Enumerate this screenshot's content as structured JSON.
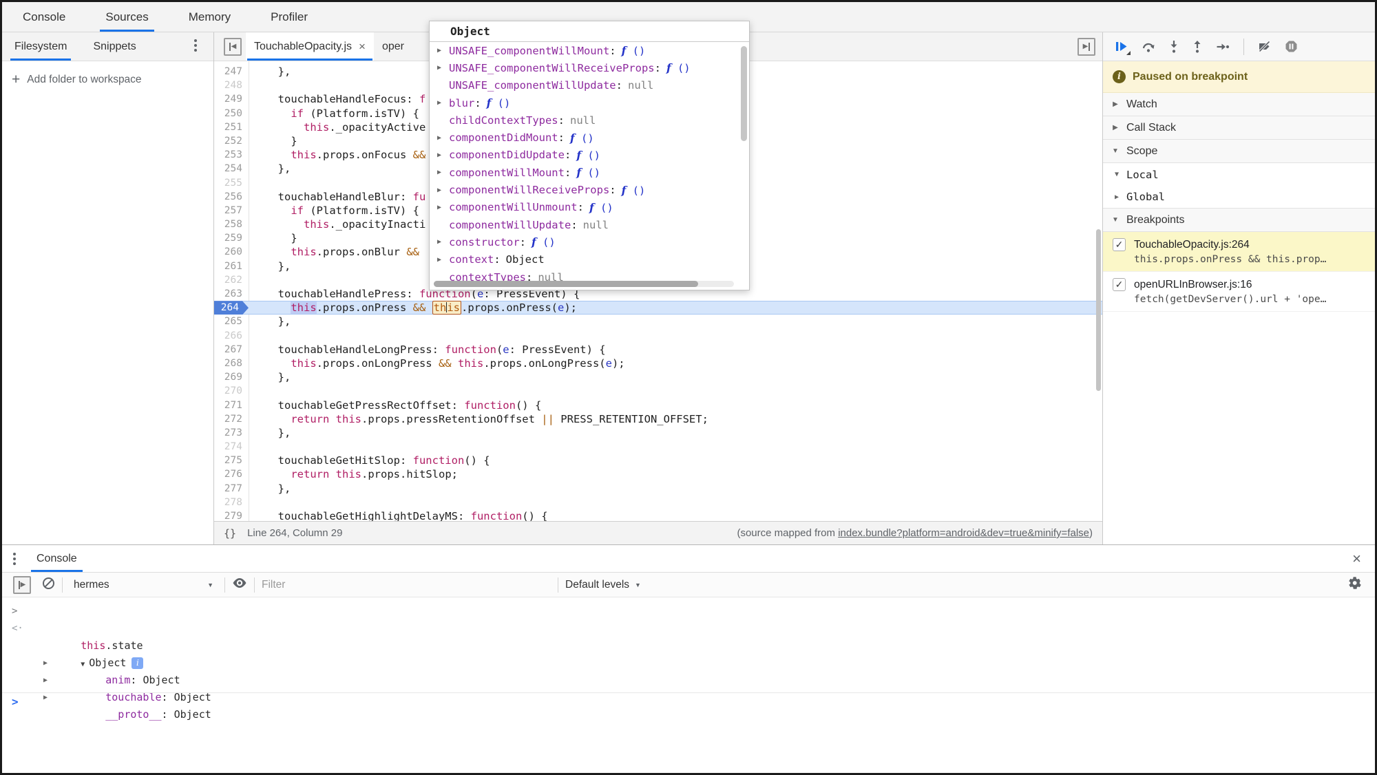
{
  "main_tabs": {
    "items": [
      {
        "label": "Console",
        "active": false
      },
      {
        "label": "Sources",
        "active": true
      },
      {
        "label": "Memory",
        "active": false
      },
      {
        "label": "Profiler",
        "active": false
      }
    ]
  },
  "sidebar": {
    "tabs": [
      {
        "label": "Filesystem",
        "active": true
      },
      {
        "label": "Snippets",
        "active": false
      }
    ],
    "add_folder_label": "Add folder to workspace"
  },
  "editor": {
    "nav_tabs": [
      {
        "label": "TouchableOpacity.js",
        "active": true
      },
      {
        "label": "oper",
        "active": false
      }
    ],
    "current_line": 264,
    "status_left": "Line 264, Column 29",
    "status_right_prefix": "(source mapped from ",
    "status_right_link": "index.bundle?platform=android&dev=true&minify=false",
    "status_right_suffix": ")",
    "lines": [
      {
        "n": 247,
        "t": [
          [
            "p",
            "  },"
          ]
        ]
      },
      {
        "n": 248,
        "t": []
      },
      {
        "n": 249,
        "t": [
          [
            "p",
            "  touchableHandleFocus: "
          ],
          [
            "k",
            "f"
          ]
        ]
      },
      {
        "n": 250,
        "t": [
          [
            "p",
            "    "
          ],
          [
            "k",
            "if"
          ],
          [
            "p",
            " (Platform.isTV) {"
          ]
        ]
      },
      {
        "n": 251,
        "t": [
          [
            "p",
            "      "
          ],
          [
            "k",
            "this"
          ],
          [
            "p",
            "._opacityActive"
          ]
        ]
      },
      {
        "n": 252,
        "t": [
          [
            "p",
            "    }"
          ]
        ]
      },
      {
        "n": 253,
        "t": [
          [
            "p",
            "    "
          ],
          [
            "k",
            "this"
          ],
          [
            "p",
            ".props.onFocus "
          ],
          [
            "o",
            "&&"
          ]
        ]
      },
      {
        "n": 254,
        "t": [
          [
            "p",
            "  },"
          ]
        ]
      },
      {
        "n": 255,
        "t": []
      },
      {
        "n": 256,
        "t": [
          [
            "p",
            "  touchableHandleBlur: "
          ],
          [
            "k",
            "fu"
          ]
        ]
      },
      {
        "n": 257,
        "t": [
          [
            "p",
            "    "
          ],
          [
            "k",
            "if"
          ],
          [
            "p",
            " (Platform.isTV) {"
          ]
        ]
      },
      {
        "n": 258,
        "t": [
          [
            "p",
            "      "
          ],
          [
            "k",
            "this"
          ],
          [
            "p",
            "._opacityInacti"
          ]
        ]
      },
      {
        "n": 259,
        "t": [
          [
            "p",
            "    }"
          ]
        ]
      },
      {
        "n": 260,
        "t": [
          [
            "p",
            "    "
          ],
          [
            "k",
            "this"
          ],
          [
            "p",
            ".props.onBlur "
          ],
          [
            "o",
            "&&"
          ]
        ]
      },
      {
        "n": 261,
        "t": [
          [
            "p",
            "  },"
          ]
        ]
      },
      {
        "n": 262,
        "t": []
      },
      {
        "n": 263,
        "t": [
          [
            "p",
            "  touchableHandlePress: "
          ],
          [
            "k",
            "function"
          ],
          [
            "p",
            "("
          ],
          [
            "b",
            "e"
          ],
          [
            "p",
            ": PressEvent) {"
          ]
        ]
      },
      {
        "n": 264,
        "t": [
          [
            "p",
            "    "
          ],
          [
            "sel",
            "this"
          ],
          [
            "p",
            ".props.onPress "
          ],
          [
            "o",
            "&&"
          ],
          [
            "p",
            " "
          ],
          [
            "box",
            "this"
          ],
          [
            "p",
            ".props.onPress("
          ],
          [
            "b",
            "e"
          ],
          [
            "p",
            ");"
          ]
        ]
      },
      {
        "n": 265,
        "t": [
          [
            "p",
            "  },"
          ]
        ]
      },
      {
        "n": 266,
        "t": []
      },
      {
        "n": 267,
        "t": [
          [
            "p",
            "  touchableHandleLongPress: "
          ],
          [
            "k",
            "function"
          ],
          [
            "p",
            "("
          ],
          [
            "b",
            "e"
          ],
          [
            "p",
            ": PressEvent) {"
          ]
        ]
      },
      {
        "n": 268,
        "t": [
          [
            "p",
            "    "
          ],
          [
            "k",
            "this"
          ],
          [
            "p",
            ".props.onLongPress "
          ],
          [
            "o",
            "&&"
          ],
          [
            "p",
            " "
          ],
          [
            "k",
            "this"
          ],
          [
            "p",
            ".props.onLongPress("
          ],
          [
            "b",
            "e"
          ],
          [
            "p",
            ");"
          ]
        ]
      },
      {
        "n": 269,
        "t": [
          [
            "p",
            "  },"
          ]
        ]
      },
      {
        "n": 270,
        "t": []
      },
      {
        "n": 271,
        "t": [
          [
            "p",
            "  touchableGetPressRectOffset: "
          ],
          [
            "k",
            "function"
          ],
          [
            "p",
            "() {"
          ]
        ]
      },
      {
        "n": 272,
        "t": [
          [
            "p",
            "    "
          ],
          [
            "k",
            "return"
          ],
          [
            "p",
            " "
          ],
          [
            "k",
            "this"
          ],
          [
            "p",
            ".props.pressRetentionOffset "
          ],
          [
            "o",
            "||"
          ],
          [
            "p",
            " PRESS_RETENTION_OFFSET;"
          ]
        ]
      },
      {
        "n": 273,
        "t": [
          [
            "p",
            "  },"
          ]
        ]
      },
      {
        "n": 274,
        "t": []
      },
      {
        "n": 275,
        "t": [
          [
            "p",
            "  touchableGetHitSlop: "
          ],
          [
            "k",
            "function"
          ],
          [
            "p",
            "() {"
          ]
        ]
      },
      {
        "n": 276,
        "t": [
          [
            "p",
            "    "
          ],
          [
            "k",
            "return"
          ],
          [
            "p",
            " "
          ],
          [
            "k",
            "this"
          ],
          [
            "p",
            ".props.hitSlop;"
          ]
        ]
      },
      {
        "n": 277,
        "t": [
          [
            "p",
            "  },"
          ]
        ]
      },
      {
        "n": 278,
        "t": []
      },
      {
        "n": 279,
        "t": [
          [
            "p",
            "  touchableGetHighlightDelayMS: "
          ],
          [
            "k",
            "function"
          ],
          [
            "p",
            "() {"
          ]
        ]
      }
    ]
  },
  "popup": {
    "title": "Object",
    "props": [
      {
        "a": true,
        "name": "UNSAFE_componentWillMount",
        "v": "f ()",
        "vt": "fn"
      },
      {
        "a": true,
        "name": "UNSAFE_componentWillReceiveProps",
        "v": "f ()",
        "vt": "fn"
      },
      {
        "a": false,
        "name": "UNSAFE_componentWillUpdate",
        "v": "null",
        "vt": "null"
      },
      {
        "a": true,
        "name": "blur",
        "v": "f ()",
        "vt": "fn"
      },
      {
        "a": false,
        "name": "childContextTypes",
        "v": "null",
        "vt": "null"
      },
      {
        "a": true,
        "name": "componentDidMount",
        "v": "f ()",
        "vt": "fn"
      },
      {
        "a": true,
        "name": "componentDidUpdate",
        "v": "f ()",
        "vt": "fn"
      },
      {
        "a": true,
        "name": "componentWillMount",
        "v": "f ()",
        "vt": "fn"
      },
      {
        "a": true,
        "name": "componentWillReceiveProps",
        "v": "f ()",
        "vt": "fn"
      },
      {
        "a": true,
        "name": "componentWillUnmount",
        "v": "f ()",
        "vt": "fn"
      },
      {
        "a": false,
        "name": "componentWillUpdate",
        "v": "null",
        "vt": "null"
      },
      {
        "a": true,
        "name": "constructor",
        "v": "f ()",
        "vt": "fn"
      },
      {
        "a": true,
        "name": "context",
        "v": "Object",
        "vt": "obj"
      },
      {
        "a": false,
        "name": "contextTypes",
        "v": "null",
        "vt": "null"
      }
    ]
  },
  "debug_panel": {
    "paused_label": "Paused on breakpoint",
    "sections": [
      {
        "label": "Watch",
        "expanded": false
      },
      {
        "label": "Call Stack",
        "expanded": false
      },
      {
        "label": "Scope",
        "expanded": true
      }
    ],
    "scope_items": [
      {
        "label": "Local",
        "expanded": true
      },
      {
        "label": "Global",
        "expanded": false
      }
    ],
    "breakpoints_label": "Breakpoints",
    "breakpoints": [
      {
        "checked": true,
        "file": "TouchableOpacity.js:264",
        "snippet": "this.props.onPress && this.prop…",
        "active": true
      },
      {
        "checked": true,
        "file": "openURLInBrowser.js:16",
        "snippet": "fetch(getDevServer().url + 'ope…",
        "active": false
      }
    ]
  },
  "console_drawer": {
    "tab_label": "Console",
    "context_value": "hermes",
    "filter_placeholder": "Filter",
    "levels_label": "Default levels",
    "input_echo": {
      "kw": "this",
      "rest": ".state"
    },
    "result_label": "Object",
    "children": [
      {
        "name": "anim",
        "value": "Object"
      },
      {
        "name": "touchable",
        "value": "Object"
      },
      {
        "name": "__proto__",
        "value": "Object"
      }
    ]
  }
}
